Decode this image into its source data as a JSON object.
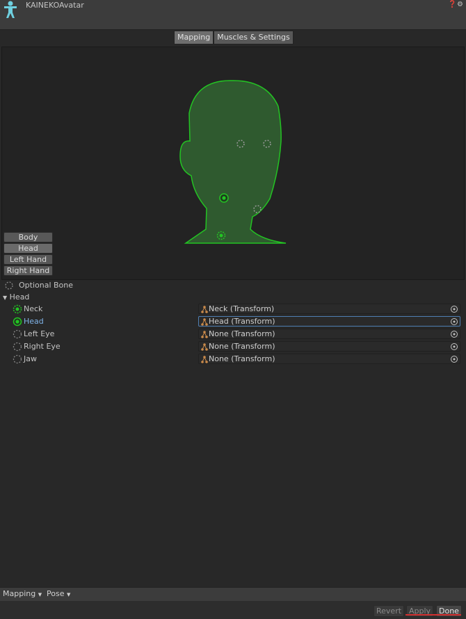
{
  "window": {
    "title": "KAINEKOAvatar",
    "icons": [
      "avatar-figure-icon",
      "help-icon",
      "settings-icon"
    ],
    "accent": "#23c423",
    "selection_color": "#7fb3e8"
  },
  "tabs": [
    {
      "label": "Mapping",
      "active": true
    },
    {
      "label": "Muscles & Settings",
      "active": false
    }
  ],
  "body_parts": [
    {
      "label": "Body",
      "active": false
    },
    {
      "label": "Head",
      "active": true
    },
    {
      "label": "Left Hand",
      "active": false
    },
    {
      "label": "Right Hand",
      "active": false
    }
  ],
  "legend": {
    "optional_bone": "Optional Bone"
  },
  "group": {
    "label": "Head",
    "expanded": true
  },
  "bones": [
    {
      "label": "Neck",
      "value": "Neck (Transform)",
      "state": "required-mapped",
      "selected": false
    },
    {
      "label": "Head",
      "value": "Head (Transform)",
      "state": "required-mapped",
      "selected": true
    },
    {
      "label": "Left Eye",
      "value": "None (Transform)",
      "state": "optional",
      "selected": false
    },
    {
      "label": "Right Eye",
      "value": "None (Transform)",
      "state": "optional",
      "selected": false
    },
    {
      "label": "Jaw",
      "value": "None (Transform)",
      "state": "optional",
      "selected": false
    }
  ],
  "bottom_bar": {
    "mapping": "Mapping",
    "pose": "Pose"
  },
  "footer": {
    "revert": "Revert",
    "apply": "Apply",
    "done": "Done"
  }
}
